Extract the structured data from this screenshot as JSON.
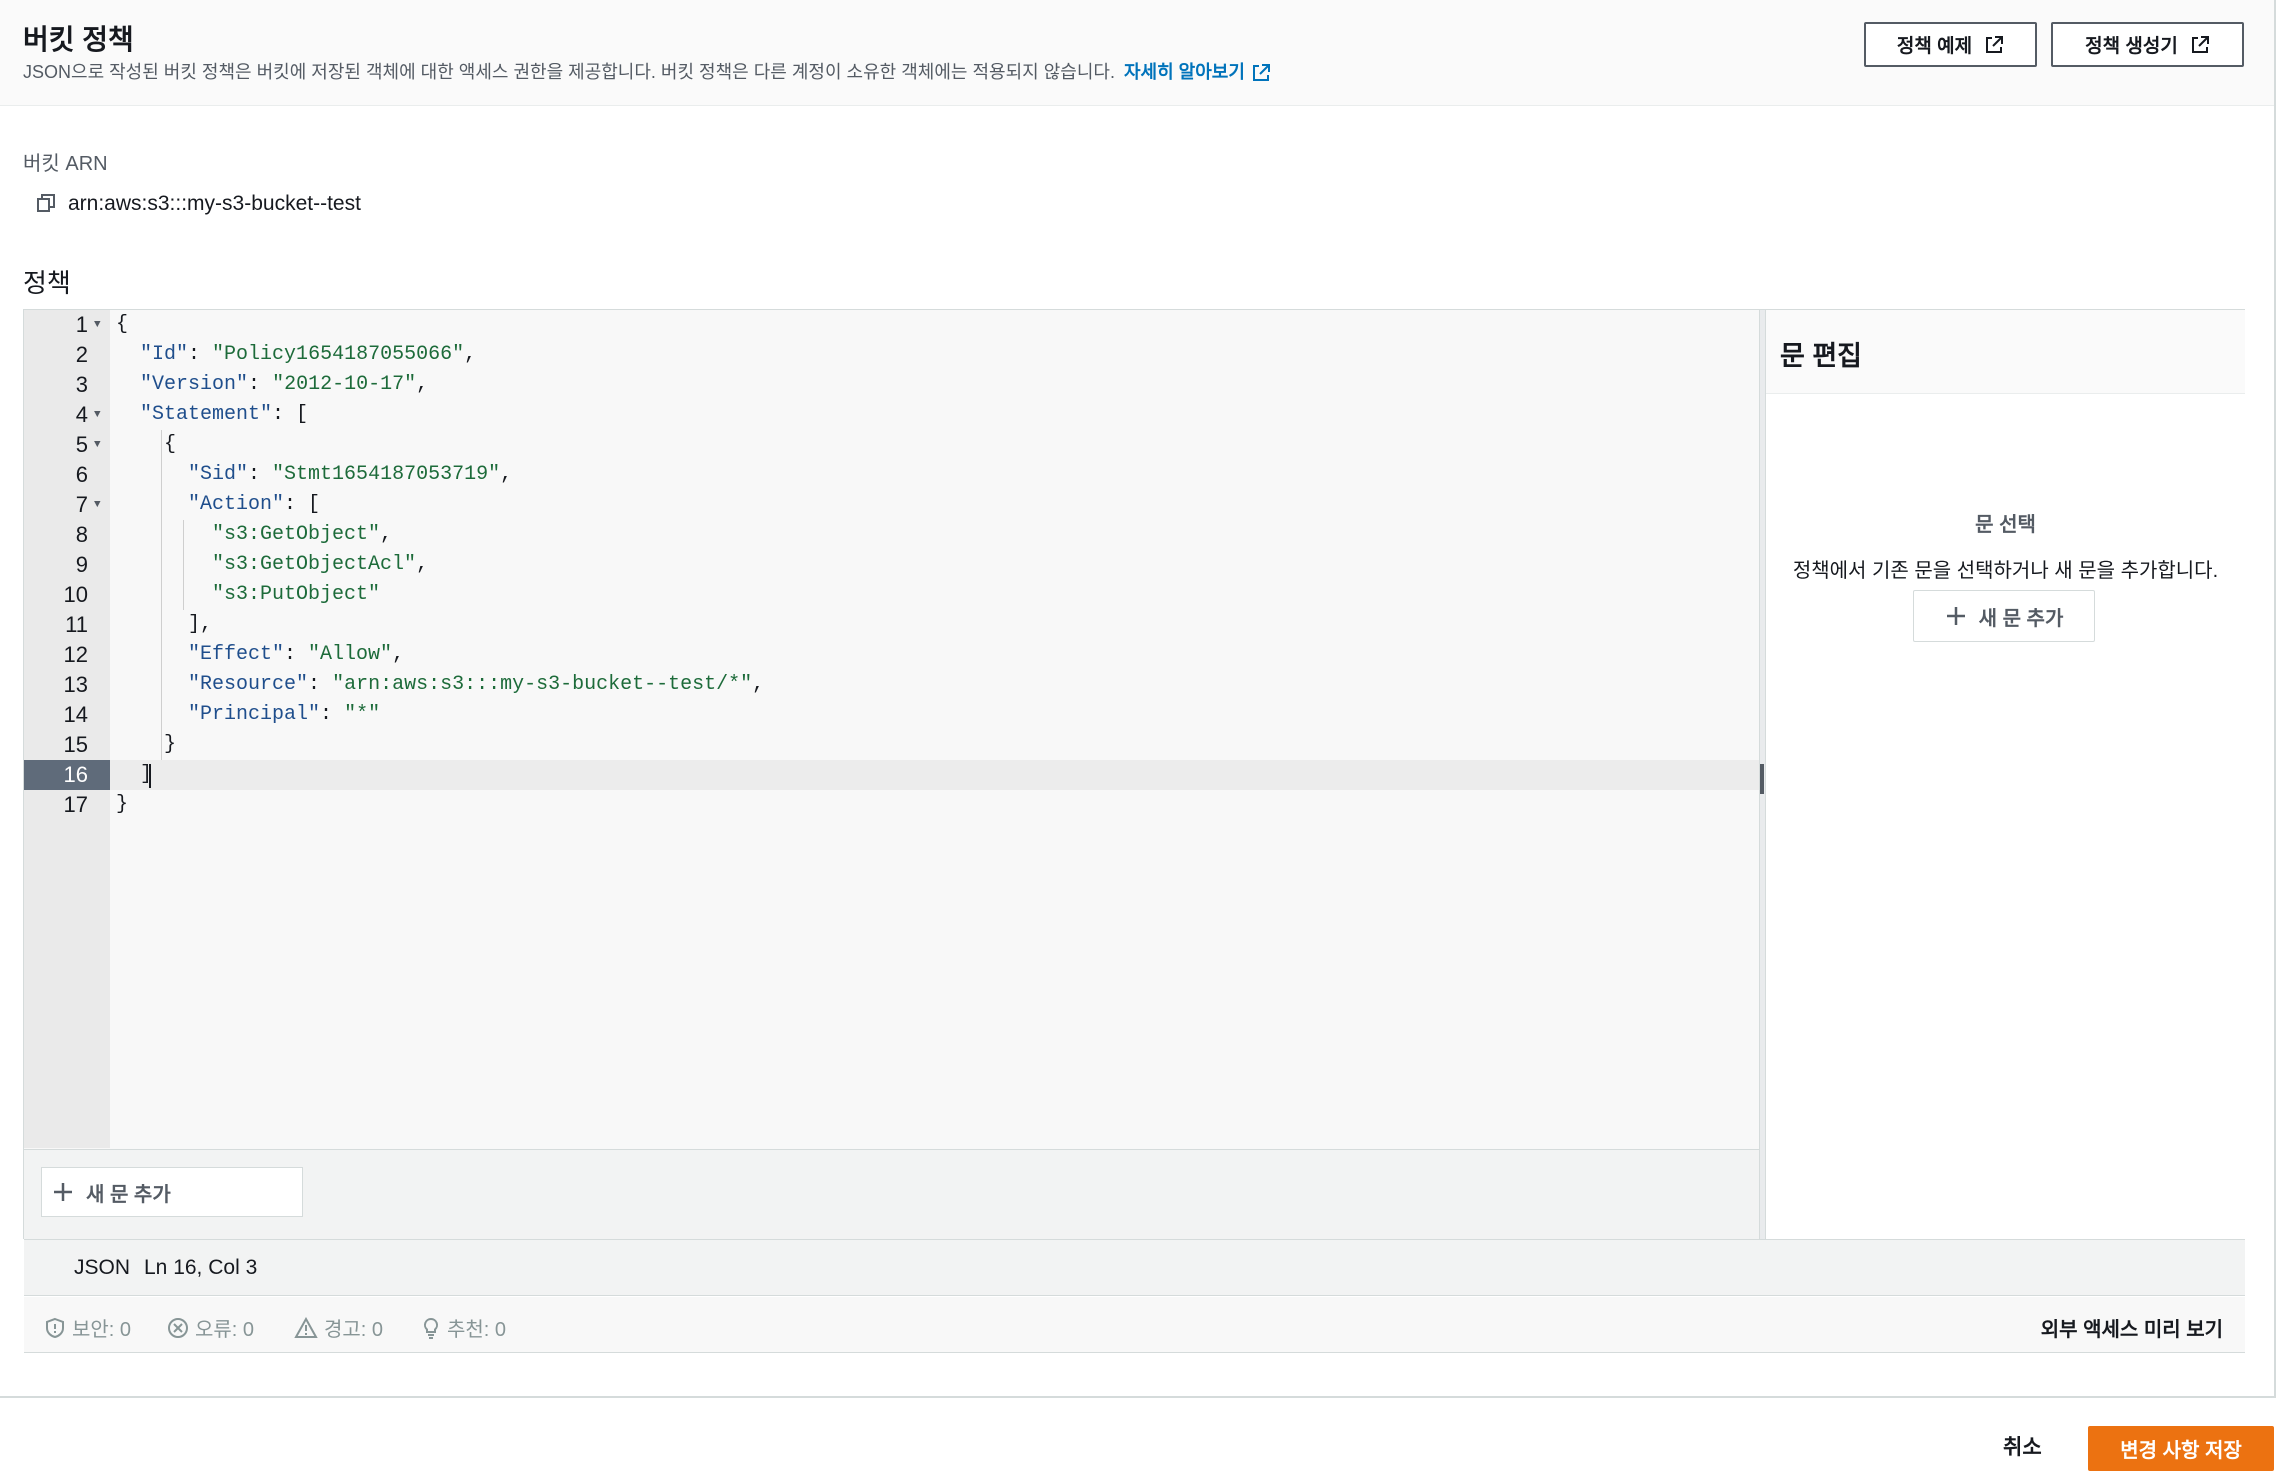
{
  "header": {
    "title": "버킷 정책",
    "description": "JSON으로 작성된 버킷 정책은 버킷에 저장된 객체에 대한 액세스 권한을 제공합니다. 버킷 정책은 다른 계정이 소유한 객체에는 적용되지 않습니다.",
    "learn_more": "자세히 알아보기",
    "btn_examples": "정책 예제",
    "btn_generator": "정책 생성기"
  },
  "arn": {
    "label": "버킷 ARN",
    "value": "arn:aws:s3:::my-s3-bucket--test"
  },
  "policy": {
    "label": "정책"
  },
  "editor": {
    "lines": [
      {
        "n": "1",
        "text": "{"
      },
      {
        "n": "2",
        "text": "  \"Id\": \"Policy1654187055066\","
      },
      {
        "n": "3",
        "text": "  \"Version\": \"2012-10-17\","
      },
      {
        "n": "4",
        "text": "  \"Statement\": ["
      },
      {
        "n": "5",
        "text": "    {"
      },
      {
        "n": "6",
        "text": "      \"Sid\": \"Stmt1654187053719\","
      },
      {
        "n": "7",
        "text": "      \"Action\": ["
      },
      {
        "n": "8",
        "text": "        \"s3:GetObject\","
      },
      {
        "n": "9",
        "text": "        \"s3:GetObjectAcl\","
      },
      {
        "n": "10",
        "text": "        \"s3:PutObject\""
      },
      {
        "n": "11",
        "text": "      ],"
      },
      {
        "n": "12",
        "text": "      \"Effect\": \"Allow\","
      },
      {
        "n": "13",
        "text": "      \"Resource\": \"arn:aws:s3:::my-s3-bucket--test/*\","
      },
      {
        "n": "14",
        "text": "      \"Principal\": \"*\""
      },
      {
        "n": "15",
        "text": "    }"
      },
      {
        "n": "16",
        "text": "  ]"
      },
      {
        "n": "17",
        "text": "}"
      }
    ],
    "fold_lines": [
      "1",
      "4",
      "5",
      "7"
    ],
    "active_line": "16",
    "add_statement": "새 문 추가"
  },
  "side_panel": {
    "title": "문 편집",
    "select_title": "문 선택",
    "select_desc": "정책에서 기존 문을 선택하거나 새 문을 추가합니다.",
    "add_statement": "새 문 추가"
  },
  "status": {
    "mode": "JSON",
    "position": "Ln 16, Col 3"
  },
  "lint": {
    "security": "보안: 0",
    "errors": "오류: 0",
    "warnings": "경고: 0",
    "suggestions": "추천: 0",
    "preview": "외부 액세스 미리 보기"
  },
  "footer": {
    "cancel": "취소",
    "save": "변경 사항 저장"
  },
  "colors": {
    "accent": "#ec7211",
    "link": "#0073bb"
  }
}
